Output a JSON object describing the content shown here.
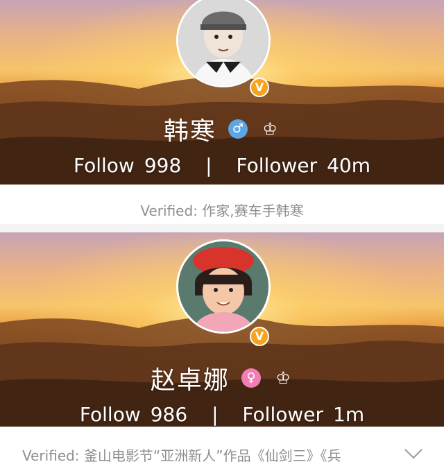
{
  "profiles": [
    {
      "name": "韩寒",
      "gender": "male",
      "gender_symbol": "♂",
      "crown_symbol": "♔",
      "verified_badge": "V",
      "follow_label": "Follow",
      "follow_count": "998",
      "separator": "|",
      "follower_label": "Follower",
      "follower_count": "40m",
      "verified_text": "Verified: 作家,赛车手韩寒",
      "avatar_icon": "child-photo-avatar"
    },
    {
      "name": "赵卓娜",
      "gender": "female",
      "gender_symbol": "♀",
      "crown_symbol": "♔",
      "verified_badge": "V",
      "follow_label": "Follow",
      "follow_count": "986",
      "separator": "|",
      "follower_label": "Follower",
      "follower_count": "1m",
      "verified_text": "Verified: 釜山电影节“亚洲新人”作品《仙剑三》《兵",
      "avatar_icon": "child-photo-avatar"
    }
  ],
  "colors": {
    "sky_top": "#c9a0b0",
    "sun": "#ffd36a",
    "verified_badge": "#f4a41e",
    "male_badge": "#5aa6e6",
    "female_badge": "#f07eb4",
    "verified_text": "#8e8e8e"
  }
}
